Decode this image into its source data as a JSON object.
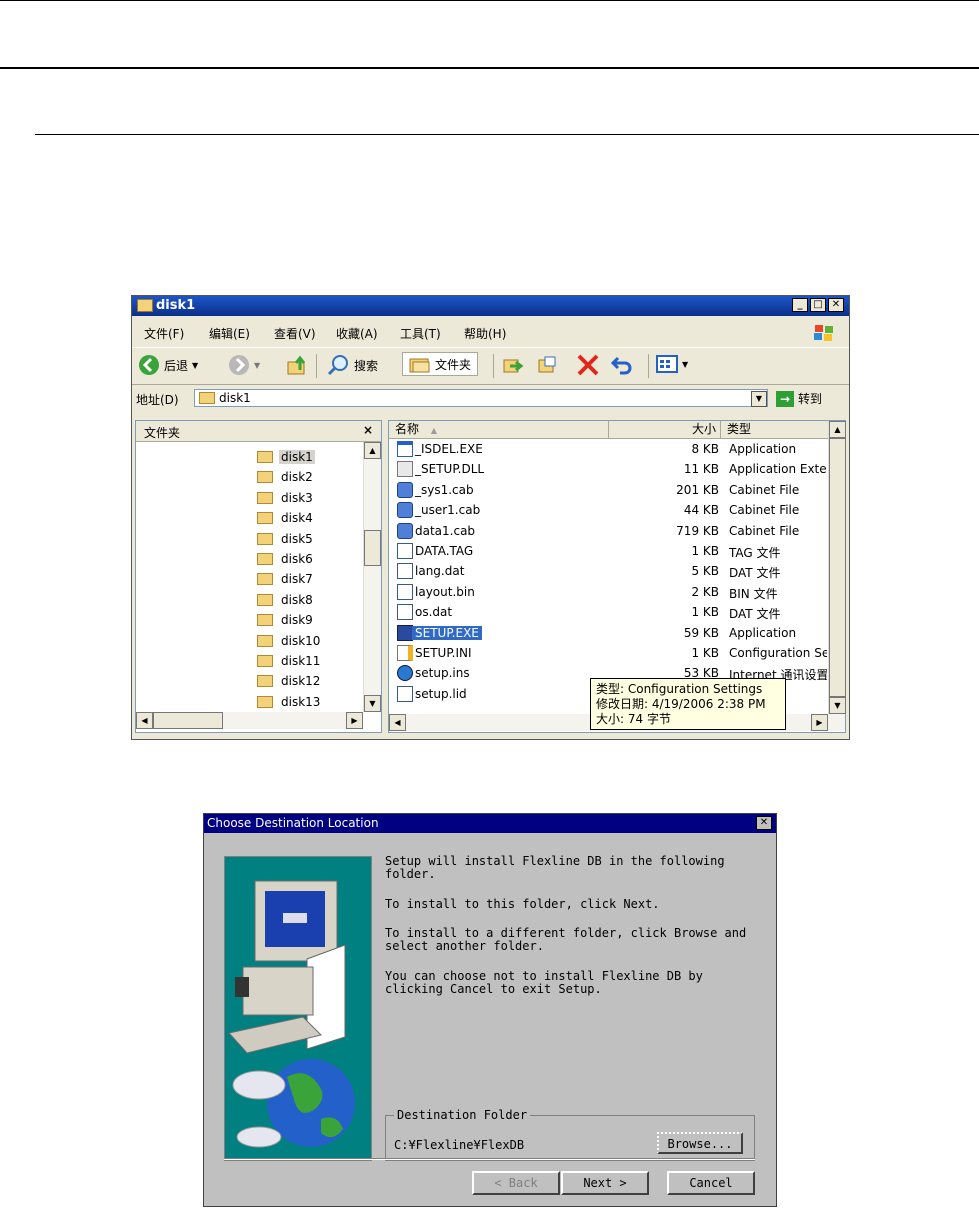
{
  "explorer": {
    "title": "disk1",
    "menu": [
      "文件(F)",
      "编辑(E)",
      "查看(V)",
      "收藏(A)",
      "工具(T)",
      "帮助(H)"
    ],
    "toolbar": {
      "back": "后退",
      "search": "搜索",
      "folders": "文件夹"
    },
    "address": {
      "label": "地址(D)",
      "value": "disk1",
      "go": "转到"
    },
    "folders_pane": {
      "title": "文件夹",
      "close": "×",
      "items": [
        "disk1",
        "disk2",
        "disk3",
        "disk4",
        "disk5",
        "disk6",
        "disk7",
        "disk8",
        "disk9",
        "disk10",
        "disk11",
        "disk12",
        "disk13"
      ],
      "selected": "disk1"
    },
    "columns": {
      "name": "名称",
      "size": "大小",
      "type": "类型"
    },
    "files": [
      {
        "name": "_ISDEL.EXE",
        "size": "8 KB",
        "type": "Application",
        "icon": "exe-window-icon"
      },
      {
        "name": "_SETUP.DLL",
        "size": "11 KB",
        "type": "Application Exter",
        "icon": "dll-icon"
      },
      {
        "name": "_sys1.cab",
        "size": "201 KB",
        "type": "Cabinet File",
        "icon": "cabinet-icon"
      },
      {
        "name": "_user1.cab",
        "size": "44 KB",
        "type": "Cabinet File",
        "icon": "cabinet-icon"
      },
      {
        "name": "data1.cab",
        "size": "719 KB",
        "type": "Cabinet File",
        "icon": "cabinet-icon"
      },
      {
        "name": "DATA.TAG",
        "size": "1 KB",
        "type": "TAG 文件",
        "icon": "generic-file-icon"
      },
      {
        "name": "lang.dat",
        "size": "5 KB",
        "type": "DAT 文件",
        "icon": "generic-file-icon"
      },
      {
        "name": "layout.bin",
        "size": "2 KB",
        "type": "BIN 文件",
        "icon": "generic-file-icon"
      },
      {
        "name": "os.dat",
        "size": "1 KB",
        "type": "DAT 文件",
        "icon": "generic-file-icon"
      },
      {
        "name": "SETUP.EXE",
        "size": "59 KB",
        "type": "Application",
        "icon": "setup-exe-icon"
      },
      {
        "name": "SETUP.INI",
        "size": "1 KB",
        "type": "Configuration Set",
        "icon": "config-file-icon"
      },
      {
        "name": "setup.ins",
        "size": "53 KB",
        "type": "Internet 通讯设置",
        "icon": "internet-settings-icon"
      },
      {
        "name": "setup.lid",
        "size": "",
        "type": "",
        "icon": "generic-file-icon"
      }
    ],
    "selected_file": "SETUP.EXE",
    "tooltip": [
      "类型: Configuration Settings",
      "修改日期: 4/19/2006 2:38 PM",
      "大小: 74 字节"
    ]
  },
  "dialog": {
    "title": "Choose Destination Location",
    "close": "×",
    "paragraphs": [
      "Setup will install Flexline DB in the following\nfolder.",
      "To install to this folder, click Next.",
      "To install to a different folder, click Browse and\nselect another folder.",
      "You can choose not to install Flexline DB by\nclicking Cancel to exit Setup."
    ],
    "group_label": "Destination Folder",
    "path": "C:¥Flexline¥FlexDB",
    "browse": "Browse...",
    "back": "< Back",
    "next": "Next >",
    "cancel": "Cancel"
  }
}
